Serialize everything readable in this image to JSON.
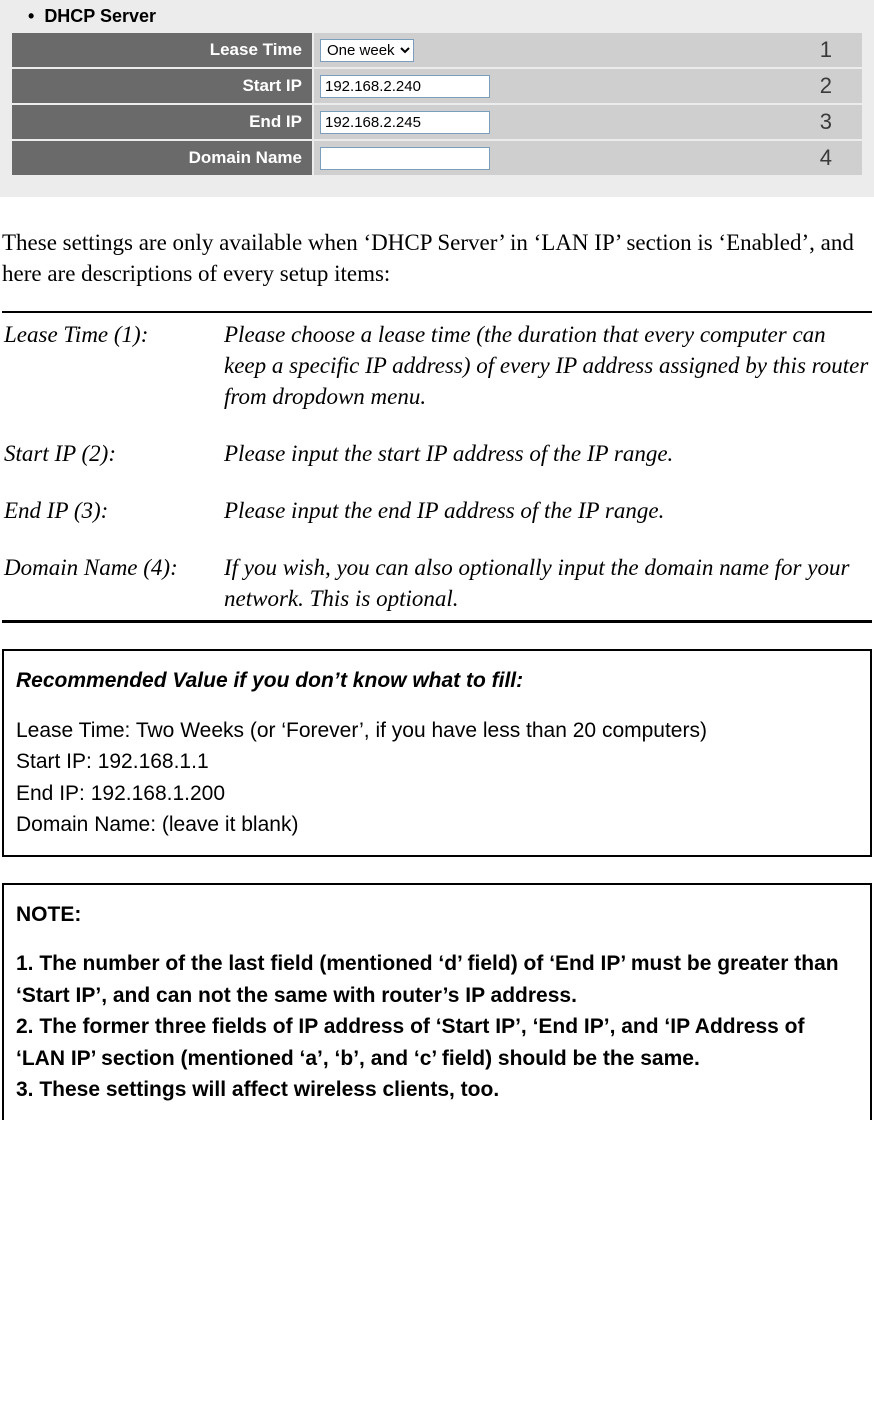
{
  "form": {
    "section_title": "DHCP Server",
    "rows": [
      {
        "label": "Lease Time",
        "type": "select",
        "value": "One week",
        "callout": "1"
      },
      {
        "label": "Start IP",
        "type": "text",
        "value": "192.168.2.240",
        "callout": "2"
      },
      {
        "label": "End IP",
        "type": "text",
        "value": "192.168.2.245",
        "callout": "3"
      },
      {
        "label": "Domain Name",
        "type": "text",
        "value": "",
        "callout": "4"
      }
    ]
  },
  "intro": "These settings are only available when ‘DHCP Server’ in ‘LAN IP’ section is ‘Enabled’, and here are descriptions of every setup items:",
  "definitions": [
    {
      "term": "Lease Time (1):",
      "desc": "Please choose a lease time (the duration that every computer can keep a specific IP address) of every IP address assigned by this router from dropdown menu."
    },
    {
      "term": "Start IP (2):",
      "desc": "Please input the start IP address of the IP range."
    },
    {
      "term": "End IP (3):",
      "desc": "Please input the end IP address of the IP range."
    },
    {
      "term": "Domain Name (4):",
      "desc": "If you wish, you can also optionally input the domain name for your network. This is optional."
    }
  ],
  "recommended": {
    "title": "Recommended Value if you don’t know what to fill:",
    "lines": [
      "Lease Time: Two Weeks (or ‘Forever’, if you have less than 20 computers)",
      "Start IP: 192.168.1.1",
      "End IP: 192.168.1.200",
      "Domain Name: (leave it blank)"
    ]
  },
  "note": {
    "title": "NOTE:",
    "lines": [
      "1. The number of the last field (mentioned ‘d’ field) of ‘End IP’ must be greater than ‘Start IP’, and can not the same with router’s IP address.",
      "2. The former three fields of IP address of ‘Start IP’, ‘End IP’, and ‘IP Address of ‘LAN IP’ section (mentioned ‘a’, ‘b’, and ‘c’ field) should be the same.",
      "3. These settings will affect wireless clients, too."
    ]
  }
}
